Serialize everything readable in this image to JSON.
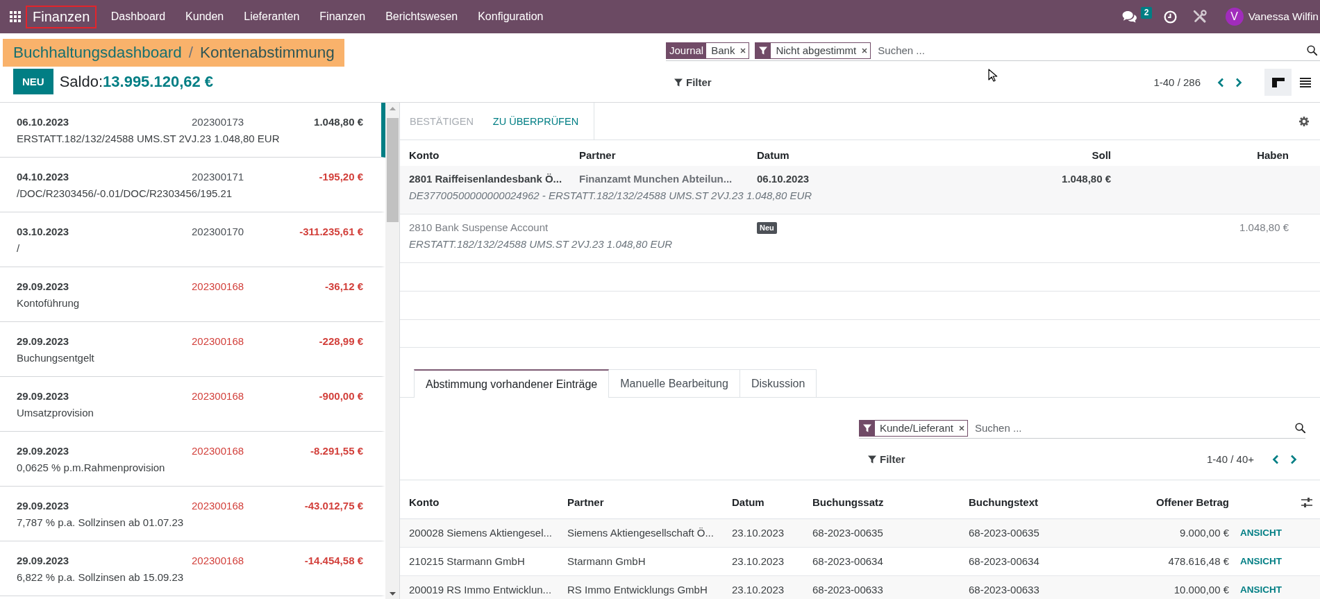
{
  "navbar": {
    "brand": {
      "label": "Finanzen",
      "outlined": true
    },
    "menu": [
      "Dashboard",
      "Kunden",
      "Lieferanten",
      "Finanzen",
      "Berichtswesen",
      "Konfiguration"
    ],
    "messages_badge": "2",
    "user": {
      "initial": "V",
      "name": "Vanessa Wilfin"
    }
  },
  "control_panel": {
    "breadcrumb": {
      "highlighted": true,
      "link": "Buchhaltungsdashboard",
      "separator": "/",
      "current": "Kontenabstimmung"
    },
    "new_button": "NEU",
    "balance": {
      "label": "Saldo:",
      "value": "13.995.120,62 €"
    },
    "search": {
      "facets": [
        {
          "kind": "field",
          "field": "Journal",
          "value": "Bank"
        },
        {
          "kind": "filter",
          "value": "Nicht abgestimmt"
        }
      ],
      "placeholder": "Suchen ..."
    },
    "filter_button": "Filter",
    "pager": "1-40 / 286",
    "views": [
      {
        "kind": "kanban",
        "selected": true
      },
      {
        "kind": "list",
        "selected": false
      }
    ]
  },
  "statements": [
    {
      "date": "06.10.2023",
      "ref": "202300173",
      "amount": "1.048,80 €",
      "label": "ERSTATT.182/132/24588 UMS.ST 2VJ.23 1.048,80 EUR",
      "selected": true,
      "ref_flagged": false,
      "outgoing": false
    },
    {
      "date": "04.10.2023",
      "ref": "202300171",
      "amount": "-195,20 €",
      "label": "/DOC/R2303456/-0.01/DOC/R2303456/195.21",
      "selected": false,
      "ref_flagged": false,
      "outgoing": true
    },
    {
      "date": "03.10.2023",
      "ref": "202300170",
      "amount": "-311.235,61 €",
      "label": "/",
      "selected": false,
      "ref_flagged": false,
      "outgoing": true
    },
    {
      "date": "29.09.2023",
      "ref": "202300168",
      "amount": "-36,12 €",
      "label": "Kontoführung",
      "selected": false,
      "ref_flagged": true,
      "outgoing": true
    },
    {
      "date": "29.09.2023",
      "ref": "202300168",
      "amount": "-228,99 €",
      "label": "Buchungsentgelt",
      "selected": false,
      "ref_flagged": true,
      "outgoing": true
    },
    {
      "date": "29.09.2023",
      "ref": "202300168",
      "amount": "-900,00 €",
      "label": "Umsatzprovision",
      "selected": false,
      "ref_flagged": true,
      "outgoing": true
    },
    {
      "date": "29.09.2023",
      "ref": "202300168",
      "amount": "-8.291,55 €",
      "label": "0,0625 % p.m.Rahmenprovision",
      "selected": false,
      "ref_flagged": true,
      "outgoing": true
    },
    {
      "date": "29.09.2023",
      "ref": "202300168",
      "amount": "-43.012,75 €",
      "label": "7,787 % p.a. Sollzinsen ab 01.07.23",
      "selected": false,
      "ref_flagged": true,
      "outgoing": true
    },
    {
      "date": "29.09.2023",
      "ref": "202300168",
      "amount": "-14.454,58 €",
      "label": "6,822 % p.a. Sollzinsen ab 15.09.23",
      "selected": false,
      "ref_flagged": true,
      "outgoing": true
    }
  ],
  "reconciliation": {
    "actions": [
      {
        "label": "BESTÄTIGEN",
        "disabled": true
      },
      {
        "label": "ZU ÜBERPRÜFEN",
        "disabled": false
      }
    ],
    "columns": [
      "Konto",
      "Partner",
      "Datum",
      "Soll",
      "Haben"
    ],
    "lines": [
      {
        "kind": "bank",
        "account": "2801 Raiffeisenlandesbank Ö...",
        "partner": "Finanzamt Munchen Abteilun...",
        "date": "06.10.2023",
        "debit": "1.048,80 €",
        "label": "DE37700500000000024962 - ERSTATT.182/132/24588 UMS.ST 2VJ.23 1.048,80 EUR"
      },
      {
        "kind": "counterpart",
        "account": "2810 Bank Suspense Account",
        "badge": "Neu",
        "credit": "1.048,80 €",
        "label": "ERSTATT.182/132/24588 UMS.ST 2VJ.23 1.048,80 EUR"
      }
    ]
  },
  "notebook": {
    "tabs": [
      {
        "label": "Abstimmung vorhandener Einträge",
        "selected": true
      },
      {
        "label": "Manuelle Bearbeitung",
        "selected": false
      },
      {
        "label": "Diskussion",
        "selected": false
      }
    ],
    "search": {
      "facets": [
        {
          "kind": "filter",
          "value": "Kunde/Lieferant"
        }
      ],
      "placeholder": "Suchen ..."
    },
    "filter_button": "Filter",
    "pager": "1-40 / 40+",
    "table": {
      "columns": [
        "Konto",
        "Partner",
        "Datum",
        "Buchungssatz",
        "Buchungstext",
        "Offener Betrag"
      ],
      "rows": [
        {
          "cells": [
            "200028 Siemens Aktiengesel...",
            "Siemens Aktiengesellschaft Ö...",
            "23.10.2023",
            "68-2023-00635",
            "68-2023-00635",
            "9.000,00 €"
          ],
          "action": "ANSICHT"
        },
        {
          "cells": [
            "210215 Starmann GmbH",
            "Starmann GmbH",
            "23.10.2023",
            "68-2023-00634",
            "68-2023-00634",
            "478.616,48 €"
          ],
          "action": "ANSICHT"
        },
        {
          "cells": [
            "200019 RS Immo Entwicklun...",
            "RS Immo Entwicklungs GmbH",
            "23.10.2023",
            "68-2023-00633",
            "68-2023-00633",
            "10.000,00 €"
          ],
          "action": "ANSICHT"
        }
      ]
    }
  }
}
